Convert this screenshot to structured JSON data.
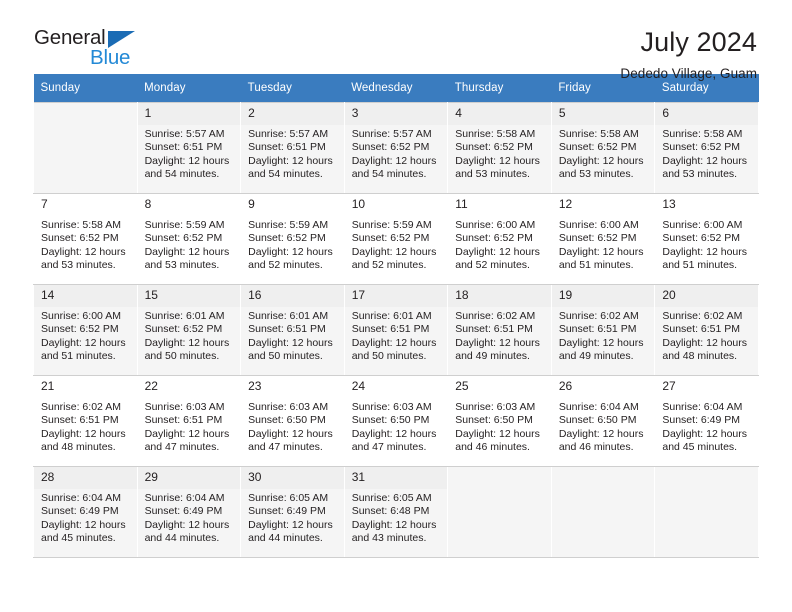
{
  "brand": {
    "name_dark": "General",
    "name_blue": "Blue",
    "triangle_color": "#1b6cb5",
    "blue_color": "#2389d6"
  },
  "header": {
    "title": "July 2024",
    "subtitle": "Dededo Village, Guam"
  },
  "theme": {
    "header_band": "#3a7cbf",
    "alt_row": "#f5f5f5",
    "grid_line": "#cfcfcf",
    "text": "#231f20"
  },
  "weekdays": [
    "Sunday",
    "Monday",
    "Tuesday",
    "Wednesday",
    "Thursday",
    "Friday",
    "Saturday"
  ],
  "weeks": [
    [
      {
        "day": "",
        "info": ""
      },
      {
        "day": "1",
        "info": "Sunrise: 5:57 AM\nSunset: 6:51 PM\nDaylight: 12 hours\nand 54 minutes."
      },
      {
        "day": "2",
        "info": "Sunrise: 5:57 AM\nSunset: 6:51 PM\nDaylight: 12 hours\nand 54 minutes."
      },
      {
        "day": "3",
        "info": "Sunrise: 5:57 AM\nSunset: 6:52 PM\nDaylight: 12 hours\nand 54 minutes."
      },
      {
        "day": "4",
        "info": "Sunrise: 5:58 AM\nSunset: 6:52 PM\nDaylight: 12 hours\nand 53 minutes."
      },
      {
        "day": "5",
        "info": "Sunrise: 5:58 AM\nSunset: 6:52 PM\nDaylight: 12 hours\nand 53 minutes."
      },
      {
        "day": "6",
        "info": "Sunrise: 5:58 AM\nSunset: 6:52 PM\nDaylight: 12 hours\nand 53 minutes."
      }
    ],
    [
      {
        "day": "7",
        "info": "Sunrise: 5:58 AM\nSunset: 6:52 PM\nDaylight: 12 hours\nand 53 minutes."
      },
      {
        "day": "8",
        "info": "Sunrise: 5:59 AM\nSunset: 6:52 PM\nDaylight: 12 hours\nand 53 minutes."
      },
      {
        "day": "9",
        "info": "Sunrise: 5:59 AM\nSunset: 6:52 PM\nDaylight: 12 hours\nand 52 minutes."
      },
      {
        "day": "10",
        "info": "Sunrise: 5:59 AM\nSunset: 6:52 PM\nDaylight: 12 hours\nand 52 minutes."
      },
      {
        "day": "11",
        "info": "Sunrise: 6:00 AM\nSunset: 6:52 PM\nDaylight: 12 hours\nand 52 minutes."
      },
      {
        "day": "12",
        "info": "Sunrise: 6:00 AM\nSunset: 6:52 PM\nDaylight: 12 hours\nand 51 minutes."
      },
      {
        "day": "13",
        "info": "Sunrise: 6:00 AM\nSunset: 6:52 PM\nDaylight: 12 hours\nand 51 minutes."
      }
    ],
    [
      {
        "day": "14",
        "info": "Sunrise: 6:00 AM\nSunset: 6:52 PM\nDaylight: 12 hours\nand 51 minutes."
      },
      {
        "day": "15",
        "info": "Sunrise: 6:01 AM\nSunset: 6:52 PM\nDaylight: 12 hours\nand 50 minutes."
      },
      {
        "day": "16",
        "info": "Sunrise: 6:01 AM\nSunset: 6:51 PM\nDaylight: 12 hours\nand 50 minutes."
      },
      {
        "day": "17",
        "info": "Sunrise: 6:01 AM\nSunset: 6:51 PM\nDaylight: 12 hours\nand 50 minutes."
      },
      {
        "day": "18",
        "info": "Sunrise: 6:02 AM\nSunset: 6:51 PM\nDaylight: 12 hours\nand 49 minutes."
      },
      {
        "day": "19",
        "info": "Sunrise: 6:02 AM\nSunset: 6:51 PM\nDaylight: 12 hours\nand 49 minutes."
      },
      {
        "day": "20",
        "info": "Sunrise: 6:02 AM\nSunset: 6:51 PM\nDaylight: 12 hours\nand 48 minutes."
      }
    ],
    [
      {
        "day": "21",
        "info": "Sunrise: 6:02 AM\nSunset: 6:51 PM\nDaylight: 12 hours\nand 48 minutes."
      },
      {
        "day": "22",
        "info": "Sunrise: 6:03 AM\nSunset: 6:51 PM\nDaylight: 12 hours\nand 47 minutes."
      },
      {
        "day": "23",
        "info": "Sunrise: 6:03 AM\nSunset: 6:50 PM\nDaylight: 12 hours\nand 47 minutes."
      },
      {
        "day": "24",
        "info": "Sunrise: 6:03 AM\nSunset: 6:50 PM\nDaylight: 12 hours\nand 47 minutes."
      },
      {
        "day": "25",
        "info": "Sunrise: 6:03 AM\nSunset: 6:50 PM\nDaylight: 12 hours\nand 46 minutes."
      },
      {
        "day": "26",
        "info": "Sunrise: 6:04 AM\nSunset: 6:50 PM\nDaylight: 12 hours\nand 46 minutes."
      },
      {
        "day": "27",
        "info": "Sunrise: 6:04 AM\nSunset: 6:49 PM\nDaylight: 12 hours\nand 45 minutes."
      }
    ],
    [
      {
        "day": "28",
        "info": "Sunrise: 6:04 AM\nSunset: 6:49 PM\nDaylight: 12 hours\nand 45 minutes."
      },
      {
        "day": "29",
        "info": "Sunrise: 6:04 AM\nSunset: 6:49 PM\nDaylight: 12 hours\nand 44 minutes."
      },
      {
        "day": "30",
        "info": "Sunrise: 6:05 AM\nSunset: 6:49 PM\nDaylight: 12 hours\nand 44 minutes."
      },
      {
        "day": "31",
        "info": "Sunrise: 6:05 AM\nSunset: 6:48 PM\nDaylight: 12 hours\nand 43 minutes."
      },
      {
        "day": "",
        "info": ""
      },
      {
        "day": "",
        "info": ""
      },
      {
        "day": "",
        "info": ""
      }
    ]
  ]
}
